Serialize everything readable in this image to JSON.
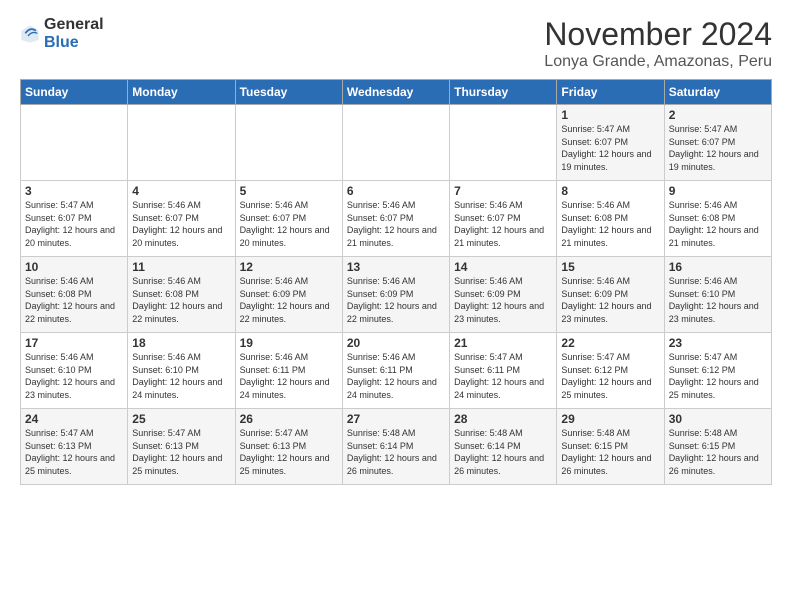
{
  "logo": {
    "general": "General",
    "blue": "Blue"
  },
  "header": {
    "month": "November 2024",
    "location": "Lonya Grande, Amazonas, Peru"
  },
  "weekdays": [
    "Sunday",
    "Monday",
    "Tuesday",
    "Wednesday",
    "Thursday",
    "Friday",
    "Saturday"
  ],
  "weeks": [
    [
      {
        "day": "",
        "info": ""
      },
      {
        "day": "",
        "info": ""
      },
      {
        "day": "",
        "info": ""
      },
      {
        "day": "",
        "info": ""
      },
      {
        "day": "",
        "info": ""
      },
      {
        "day": "1",
        "info": "Sunrise: 5:47 AM\nSunset: 6:07 PM\nDaylight: 12 hours and 19 minutes."
      },
      {
        "day": "2",
        "info": "Sunrise: 5:47 AM\nSunset: 6:07 PM\nDaylight: 12 hours and 19 minutes."
      }
    ],
    [
      {
        "day": "3",
        "info": "Sunrise: 5:47 AM\nSunset: 6:07 PM\nDaylight: 12 hours and 20 minutes."
      },
      {
        "day": "4",
        "info": "Sunrise: 5:46 AM\nSunset: 6:07 PM\nDaylight: 12 hours and 20 minutes."
      },
      {
        "day": "5",
        "info": "Sunrise: 5:46 AM\nSunset: 6:07 PM\nDaylight: 12 hours and 20 minutes."
      },
      {
        "day": "6",
        "info": "Sunrise: 5:46 AM\nSunset: 6:07 PM\nDaylight: 12 hours and 21 minutes."
      },
      {
        "day": "7",
        "info": "Sunrise: 5:46 AM\nSunset: 6:07 PM\nDaylight: 12 hours and 21 minutes."
      },
      {
        "day": "8",
        "info": "Sunrise: 5:46 AM\nSunset: 6:08 PM\nDaylight: 12 hours and 21 minutes."
      },
      {
        "day": "9",
        "info": "Sunrise: 5:46 AM\nSunset: 6:08 PM\nDaylight: 12 hours and 21 minutes."
      }
    ],
    [
      {
        "day": "10",
        "info": "Sunrise: 5:46 AM\nSunset: 6:08 PM\nDaylight: 12 hours and 22 minutes."
      },
      {
        "day": "11",
        "info": "Sunrise: 5:46 AM\nSunset: 6:08 PM\nDaylight: 12 hours and 22 minutes."
      },
      {
        "day": "12",
        "info": "Sunrise: 5:46 AM\nSunset: 6:09 PM\nDaylight: 12 hours and 22 minutes."
      },
      {
        "day": "13",
        "info": "Sunrise: 5:46 AM\nSunset: 6:09 PM\nDaylight: 12 hours and 22 minutes."
      },
      {
        "day": "14",
        "info": "Sunrise: 5:46 AM\nSunset: 6:09 PM\nDaylight: 12 hours and 23 minutes."
      },
      {
        "day": "15",
        "info": "Sunrise: 5:46 AM\nSunset: 6:09 PM\nDaylight: 12 hours and 23 minutes."
      },
      {
        "day": "16",
        "info": "Sunrise: 5:46 AM\nSunset: 6:10 PM\nDaylight: 12 hours and 23 minutes."
      }
    ],
    [
      {
        "day": "17",
        "info": "Sunrise: 5:46 AM\nSunset: 6:10 PM\nDaylight: 12 hours and 23 minutes."
      },
      {
        "day": "18",
        "info": "Sunrise: 5:46 AM\nSunset: 6:10 PM\nDaylight: 12 hours and 24 minutes."
      },
      {
        "day": "19",
        "info": "Sunrise: 5:46 AM\nSunset: 6:11 PM\nDaylight: 12 hours and 24 minutes."
      },
      {
        "day": "20",
        "info": "Sunrise: 5:46 AM\nSunset: 6:11 PM\nDaylight: 12 hours and 24 minutes."
      },
      {
        "day": "21",
        "info": "Sunrise: 5:47 AM\nSunset: 6:11 PM\nDaylight: 12 hours and 24 minutes."
      },
      {
        "day": "22",
        "info": "Sunrise: 5:47 AM\nSunset: 6:12 PM\nDaylight: 12 hours and 25 minutes."
      },
      {
        "day": "23",
        "info": "Sunrise: 5:47 AM\nSunset: 6:12 PM\nDaylight: 12 hours and 25 minutes."
      }
    ],
    [
      {
        "day": "24",
        "info": "Sunrise: 5:47 AM\nSunset: 6:13 PM\nDaylight: 12 hours and 25 minutes."
      },
      {
        "day": "25",
        "info": "Sunrise: 5:47 AM\nSunset: 6:13 PM\nDaylight: 12 hours and 25 minutes."
      },
      {
        "day": "26",
        "info": "Sunrise: 5:47 AM\nSunset: 6:13 PM\nDaylight: 12 hours and 25 minutes."
      },
      {
        "day": "27",
        "info": "Sunrise: 5:48 AM\nSunset: 6:14 PM\nDaylight: 12 hours and 26 minutes."
      },
      {
        "day": "28",
        "info": "Sunrise: 5:48 AM\nSunset: 6:14 PM\nDaylight: 12 hours and 26 minutes."
      },
      {
        "day": "29",
        "info": "Sunrise: 5:48 AM\nSunset: 6:15 PM\nDaylight: 12 hours and 26 minutes."
      },
      {
        "day": "30",
        "info": "Sunrise: 5:48 AM\nSunset: 6:15 PM\nDaylight: 12 hours and 26 minutes."
      }
    ]
  ]
}
